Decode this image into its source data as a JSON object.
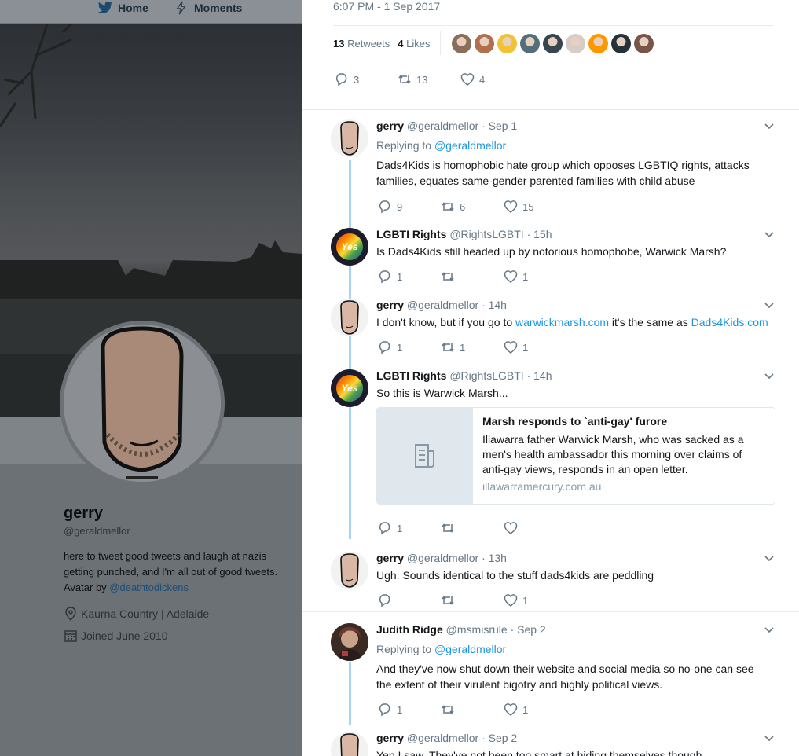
{
  "nav": {
    "home": "Home",
    "moments": "Moments"
  },
  "profile": {
    "name": "gerry",
    "handle": "@geraldmellor",
    "bio": "here to tweet good tweets and laugh at nazis getting punched, and I'm all out of good tweets. Avatar by ",
    "bio_link": "@deathtodickens",
    "location": "Kaurna Country | Adelaide",
    "joined": "Joined June 2010"
  },
  "main_tweet": {
    "time": "6:07 PM - 1 Sep 2017",
    "retweets_count": "13",
    "retweets_label": "Retweets",
    "likes_count": "4",
    "likes_label": "Likes",
    "reply_count": "3",
    "retweet_count": "13",
    "like_count": "4",
    "liker_colors": [
      "#8a6e5a",
      "#b0704e",
      "#f1c232",
      "#546e7a",
      "#37474f",
      "#d7ccc8",
      "#ff9800",
      "#263238",
      "#795548"
    ]
  },
  "replies": [
    {
      "name": "gerry",
      "handle": "@geraldmellor",
      "time": "· Sep 1",
      "replying_label": "Replying to",
      "replying_to": "@geraldmellor",
      "text": "Dads4Kids is homophobic hate group which opposes LGBTIQ rights, attacks families, equates same-gender parented families with child abuse",
      "replies": "9",
      "retweets": "6",
      "likes": "15"
    },
    {
      "name": "LGBTI Rights",
      "handle": "@RightsLGBTI",
      "time": "· 15h",
      "text": "Is Dads4Kids still headed up by notorious homophobe, Warwick Marsh?",
      "replies": "1",
      "retweets": "",
      "likes": "1"
    },
    {
      "name": "gerry",
      "handle": "@geraldmellor",
      "time": "· 14h",
      "text_a": "I don't know, but if you go to ",
      "link_a": "warwickmarsh.com",
      "text_b": " it's the same as ",
      "link_b": "Dads4Kids.com",
      "replies": "1",
      "retweets": "1",
      "likes": "1"
    },
    {
      "name": "LGBTI Rights",
      "handle": "@RightsLGBTI",
      "time": "· 14h",
      "text": "So this is Warwick Marsh...",
      "card_title": "Marsh responds to `anti-gay' furore",
      "card_desc": "Illawarra father Warwick Marsh, who was sacked as a men's health ambassador this morning over claims of anti-gay views, responds in an open letter.",
      "card_domain": "illawarramercury.com.au",
      "replies": "1",
      "retweets": "",
      "likes": ""
    },
    {
      "name": "gerry",
      "handle": "@geraldmellor",
      "time": "· 13h",
      "text": "Ugh. Sounds identical to the stuff dads4kids are peddling",
      "replies": "",
      "retweets": "",
      "likes": "1"
    },
    {
      "name": "Judith Ridge",
      "handle": "@msmisrule",
      "time": "· Sep 2",
      "replying_label": "Replying to",
      "replying_to": "@geraldmellor",
      "text": "And they've now shut down their website and social media so no-one can see the extent of their  virulent bigotry and highly political views.",
      "replies": "1",
      "retweets": "",
      "likes": "1"
    },
    {
      "name": "gerry",
      "handle": "@geraldmellor",
      "time": "· Sep 2",
      "text": "Yep I saw. They've not been too smart at hiding themselves though"
    }
  ]
}
